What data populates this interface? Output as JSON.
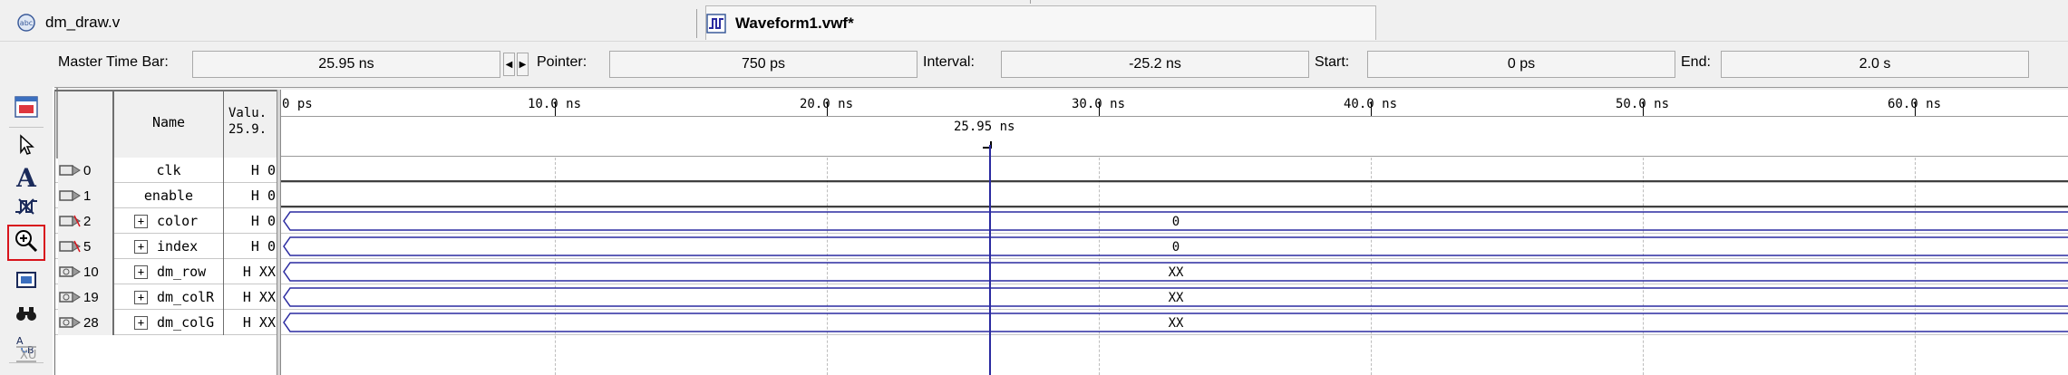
{
  "tabs": [
    {
      "label": "dm_draw.v",
      "icon": "verilog-file-icon"
    },
    {
      "label": "Waveform1.vwf*",
      "icon": "waveform-file-icon"
    }
  ],
  "timebar": {
    "master_label": "Master Time Bar:",
    "master_value": "25.95 ns",
    "pointer_label": "Pointer:",
    "pointer_value": "750 ps",
    "interval_label": "Interval:",
    "interval_value": "-25.2 ns",
    "start_label": "Start:",
    "start_value": "0 ps",
    "end_label": "End:",
    "end_value": "2.0 s"
  },
  "toolbar": [
    {
      "name": "waveform-editor-icon"
    },
    {
      "name": "selection-tool-icon"
    },
    {
      "name": "text-tool-icon"
    },
    {
      "name": "waveform-editing-tool-icon"
    },
    {
      "name": "zoom-tool-icon",
      "selected": true
    },
    {
      "name": "full-screen-icon"
    },
    {
      "name": "find-icon"
    },
    {
      "name": "replace-icon"
    },
    {
      "name": "uninitialized-icon"
    }
  ],
  "header": {
    "name_col": "Name",
    "value_col_line1": "Valu.",
    "value_col_line2": "25.9.",
    "time_ticks": [
      "0 ps",
      "10.0 ns",
      "20.0 ns",
      "30.0 ns",
      "40.0 ns",
      "50.0 ns",
      "60.0 ns"
    ],
    "cursor_label": "25.95 ns"
  },
  "signals": [
    {
      "index": "0",
      "name": "clk",
      "value": "H 0",
      "expandable": false,
      "bus_value": ""
    },
    {
      "index": "1",
      "name": "enable",
      "value": "H 0",
      "expandable": false,
      "bus_value": ""
    },
    {
      "index": "2",
      "name": "color",
      "value": "H 0",
      "expandable": true,
      "bus_value": "0"
    },
    {
      "index": "5",
      "name": "index",
      "value": "H 0",
      "expandable": true,
      "bus_value": "0"
    },
    {
      "index": "10",
      "name": "dm_row",
      "value": "H XX",
      "expandable": true,
      "bus_value": "XX"
    },
    {
      "index": "19",
      "name": "dm_colR",
      "value": "H XX",
      "expandable": true,
      "bus_value": "XX"
    },
    {
      "index": "28",
      "name": "dm_colG",
      "value": "H XX",
      "expandable": true,
      "bus_value": "XX"
    }
  ],
  "colors": {
    "waveform": "#2a2aa0",
    "cursor": "#2a2aa0",
    "selected_tool_border": "#d8141c",
    "panel_bg": "#f0f0f0"
  }
}
